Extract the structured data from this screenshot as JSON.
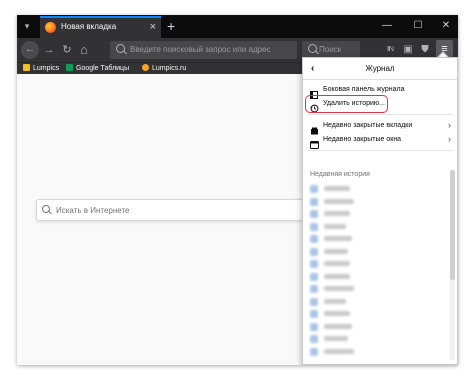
{
  "tab": {
    "title": "Новая вкладка",
    "close": "×"
  },
  "tabbar": {
    "new_tab": "+",
    "minimize": "—",
    "maximize": "☐",
    "close": "✕",
    "left_icon": "▾"
  },
  "toolbar": {
    "back": "←",
    "forward": "→",
    "reload": "↻",
    "home": "⌂",
    "url_placeholder": "Введите поисковый запрос или адрес",
    "search_placeholder": "Поиск",
    "library_icon": "IIN",
    "sidebar_icon": "▣",
    "shield_icon": "⛊",
    "menu_icon": "≡"
  },
  "bookmarks": [
    {
      "label": "Lumpics",
      "icon_color": "#f0c020"
    },
    {
      "label": "Google Таблицы",
      "icon_color": "#0f9d58"
    },
    {
      "label": "Lumpics.ru",
      "icon_color": "#f5a623"
    }
  ],
  "page": {
    "search_placeholder": "Искать в Интернете"
  },
  "panel": {
    "back": "‹",
    "title": "Журнал",
    "items": [
      {
        "label": "Боковая панель журнала"
      },
      {
        "label": "Удалить историю..."
      },
      {
        "label": "Недавно закрытые вкладки",
        "arrow": "›"
      },
      {
        "label": "Недавно закрытые окна",
        "arrow": "›"
      }
    ],
    "section_title": "Недавняя история",
    "highlight_color": "#e0324b"
  },
  "colors": {
    "tab_strip": "#0c0c0d",
    "toolbar": "#323234",
    "accent": "#0a84ff",
    "content_bg": "#f9f9fa"
  }
}
